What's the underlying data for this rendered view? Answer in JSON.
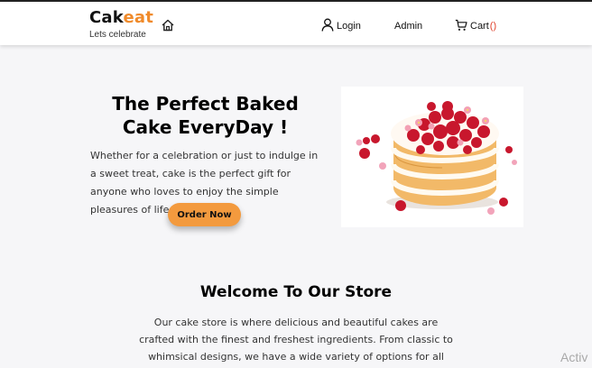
{
  "navbar": {
    "brand_part1": "Cak",
    "brand_part2": "eat",
    "tagline": "Lets celebrate",
    "home_icon": "home-icon",
    "login_label": "Login",
    "admin_label": "Admin",
    "cart_label": "Cart",
    "cart_count": "()"
  },
  "hero": {
    "title_line1": "The Perfect Baked",
    "title_line2": "Cake EveryDay !",
    "text": "Whether for a celebration or just to indulge in a sweet treat, cake is the perfect gift for anyone who loves to enjoy the simple pleasures of life.",
    "button_label": "Order Now",
    "image": "strawberry-cake-image"
  },
  "welcome": {
    "title": "Welcome To Our Store",
    "text": "Our cake store is where delicious and beautiful cakes are crafted with the finest and freshest ingredients. From classic to whimsical designs, we have a wide variety of options for all occasions."
  },
  "watermark": "Activ",
  "colors": {
    "accent": "#f08a2a",
    "button": "#f39a3e",
    "cart_count": "#e0402a",
    "background": "#f6f6f8"
  }
}
